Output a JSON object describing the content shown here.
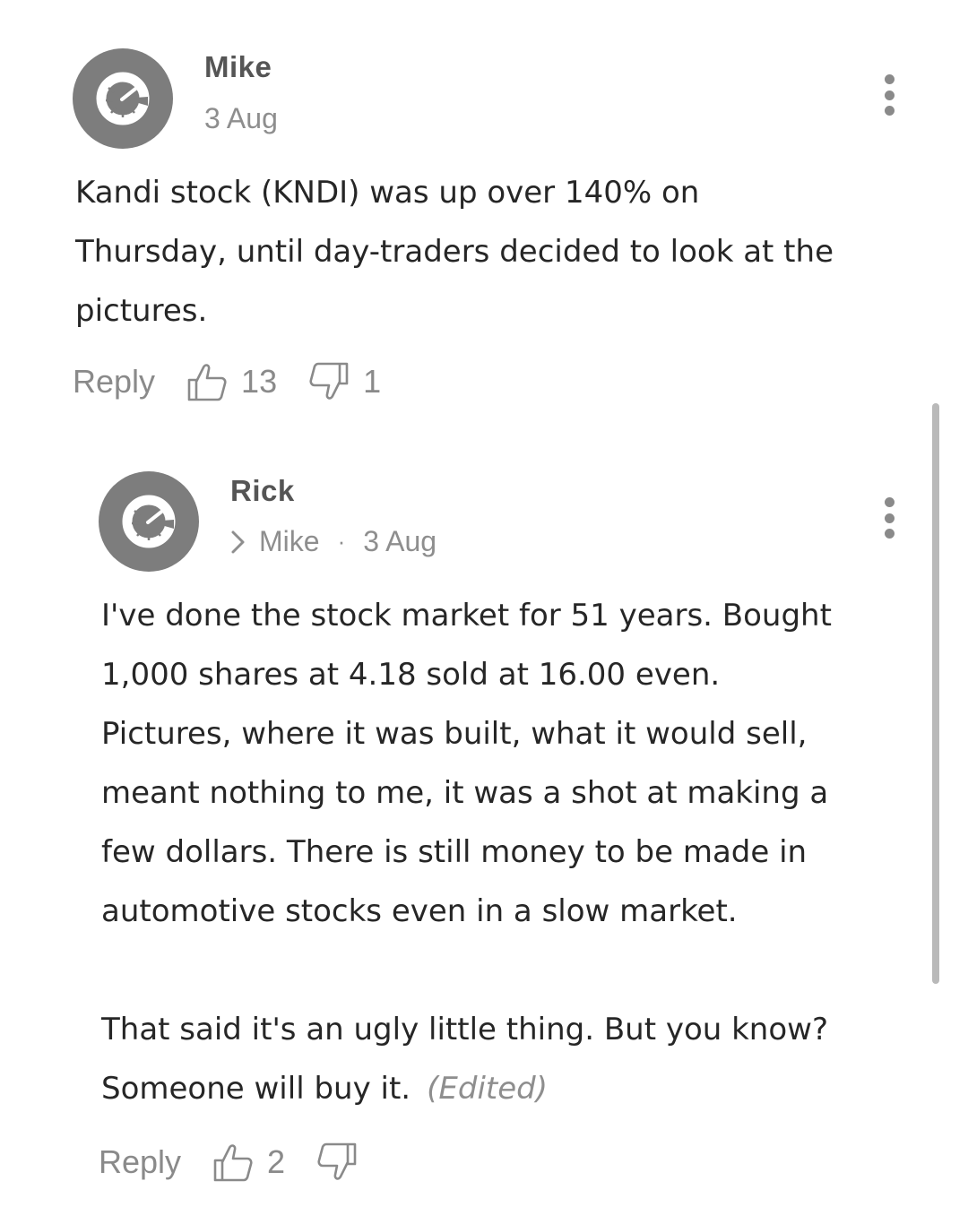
{
  "comments": [
    {
      "author": "Mike",
      "date": "3 Aug",
      "text_lines": [
        "Kandi stock (KNDI) was up over 140% on",
        "Thursday, until day-traders decided to look at the",
        "pictures."
      ],
      "reply_label": "Reply",
      "upvotes": "13",
      "downvotes": "1"
    },
    {
      "author": "Rick",
      "reply_to": "Mike",
      "separator": "·",
      "date": "3 Aug",
      "paragraph1_lines": [
        "I've done the stock market for 51 years.  Bought",
        "1,000 shares at 4.18 sold at 16.00 even.",
        "Pictures, where it was built, what it would sell,",
        "meant nothing to me, it was a shot at making a",
        "few dollars.  There is still money to be made in",
        "automotive stocks even in a slow market."
      ],
      "paragraph2_lines": [
        "That said it's an ugly little thing.  But you know?",
        "Someone will buy it."
      ],
      "edited_label": "(Edited)",
      "reply_label": "Reply",
      "upvotes": "2"
    }
  ],
  "icons": {
    "avatar": "gauge-logo-icon",
    "more": "kebab-menu-icon",
    "upvote": "thumbs-up-icon",
    "downvote": "thumbs-down-icon",
    "reply_indicator": "chevron-right-icon"
  },
  "colors": {
    "avatar_bg": "#7d7d7d",
    "muted_text": "#8e8e8e",
    "body_text": "#262626",
    "scrollbar": "#b9b9b9"
  }
}
